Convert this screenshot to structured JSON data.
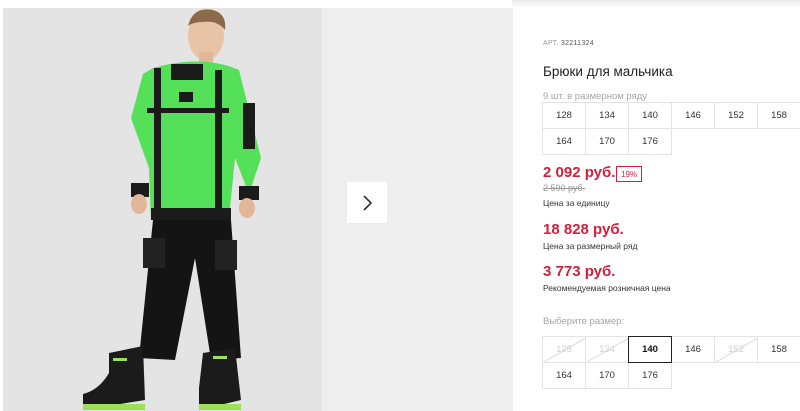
{
  "product": {
    "article_label": "АРТ.",
    "article_number": "32211324",
    "title": "Брюки для мальчика",
    "pack_note": "9 шт. в размерном ряду",
    "pack_sizes": [
      "128",
      "134",
      "140",
      "146",
      "152",
      "158",
      "164",
      "170",
      "176"
    ]
  },
  "prices": {
    "unit_price": "2 092 руб.",
    "discount_badge": "19%",
    "old_price": "2 590 руб.",
    "unit_label": "Цена за единицу",
    "pack_price": "18 828 руб.",
    "pack_label": "Цена за размерный ряд",
    "rrp_price": "3 773 руб.",
    "rrp_label": "Рекомендуемая розничная цена"
  },
  "size_selector": {
    "label": "Выберите размер:",
    "options": [
      {
        "value": "128",
        "state": "disabled"
      },
      {
        "value": "134",
        "state": "disabled"
      },
      {
        "value": "140",
        "state": "selected"
      },
      {
        "value": "146",
        "state": "available"
      },
      {
        "value": "152",
        "state": "disabled"
      },
      {
        "value": "158",
        "state": "available"
      },
      {
        "value": "164",
        "state": "available"
      },
      {
        "value": "170",
        "state": "available"
      },
      {
        "value": "176",
        "state": "available"
      }
    ]
  },
  "gallery": {
    "next_icon": "chevron-right-icon"
  },
  "colors": {
    "price_red": "#d3203a",
    "sweatshirt_green": "#55e05a",
    "selected_border": "#222222"
  }
}
